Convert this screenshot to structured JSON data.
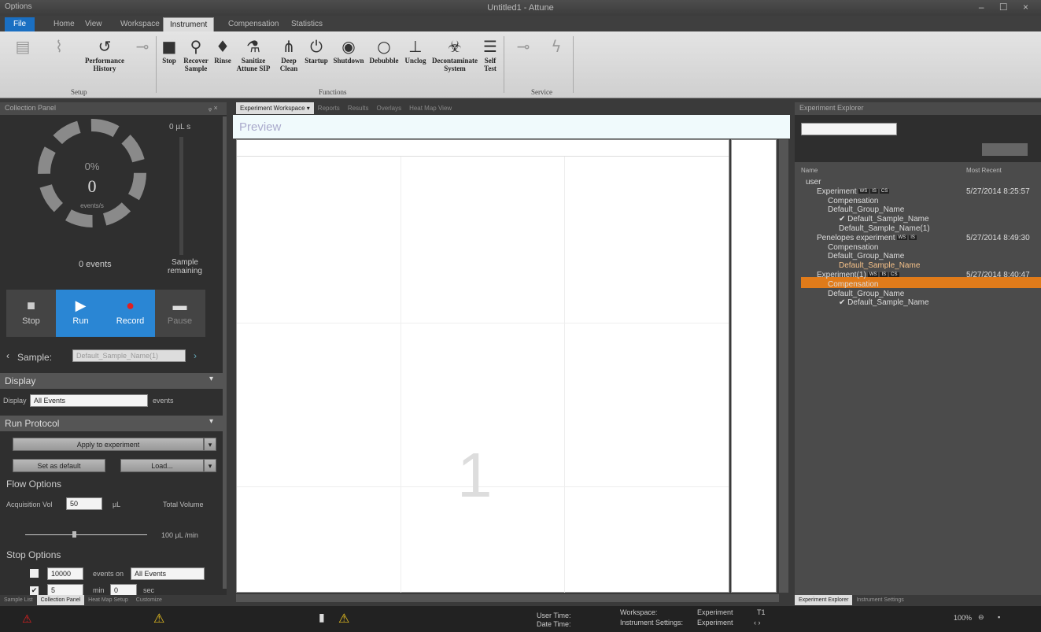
{
  "window": {
    "title": "Untitled1 - Attune",
    "quick_access": "Options",
    "controls": "– ☐ ×"
  },
  "ribbon": {
    "tabs": [
      "File",
      "Home",
      "View",
      "Workspace",
      "Instrument",
      "Compensation",
      "Statistics"
    ],
    "active_tab": "Instrument",
    "buttons": {
      "performance_history": "Performance History",
      "stop": "Stop",
      "recover_sample": "Recover Sample",
      "rinse": "Rinse",
      "sanitize": "Sanitize Attune SIP",
      "deep_clean": "Deep Clean",
      "startup": "Startup",
      "shutdown": "Shutdown",
      "debubble": "Debubble",
      "unclog": "Unclog",
      "decontaminate": "Decontaminate System",
      "self_test": "Self Test"
    },
    "groups": {
      "setup": "Setup",
      "functions": "Functions",
      "service": "Service"
    }
  },
  "collection_panel": {
    "title": "Collection Panel",
    "pin": "ᵩ ×",
    "volume": "0 µL s",
    "percent": "0%",
    "events_rate": "0",
    "events_rate_unit": "events/s",
    "events_total": "0 events",
    "sample_remaining": "Sample remaining",
    "buttons": {
      "stop": "Stop",
      "run": "Run",
      "record": "Record",
      "pause": "Pause"
    },
    "sample_label": "Sample:",
    "sample_value": "Default_Sample_Name(1)",
    "display": {
      "header": "Display",
      "label": "Display",
      "value": "All Events",
      "suffix": "events"
    },
    "run_protocol": {
      "header": "Run Protocol",
      "apply": "Apply to experiment",
      "set_default": "Set as default",
      "load": "Load...",
      "flow_options": "Flow Options",
      "acq_vol_label": "Acquisition Vol",
      "acq_vol_value": "50",
      "acq_vol_unit": "µL",
      "total_volume": "Total Volume",
      "flow_rate": "100 µL /min",
      "stop_options": "Stop Options",
      "events_value": "10000",
      "events_on": "events on",
      "events_gate": "All Events",
      "min_value": "5",
      "min_unit": "min",
      "sec_value": "0",
      "sec_unit": "sec"
    },
    "bottom_tabs": [
      "Sample List",
      "Collection Panel",
      "Heat Map Setup",
      "Customize"
    ]
  },
  "workspace": {
    "tabs": [
      "Experiment Workspace ▾",
      "Reports",
      "Results",
      "Overlays",
      "Heat Map View"
    ],
    "preview_title": "Preview",
    "page_number": "1"
  },
  "explorer": {
    "title": "Experiment Explorer",
    "col_name": "Name",
    "col_recent": "Most Recent",
    "tree": [
      {
        "level": 0,
        "text": "user",
        "icon": "▴ ▪"
      },
      {
        "level": 1,
        "text": "Experiment",
        "tags": [
          "WS",
          "IS",
          "CS"
        ],
        "date": "5/27/2014 8:25:57"
      },
      {
        "level": 2,
        "text": "Compensation"
      },
      {
        "level": 2,
        "text": "Default_Group_Name"
      },
      {
        "level": 3,
        "text": "✔ Default_Sample_Name"
      },
      {
        "level": 3,
        "text": "Default_Sample_Name(1)"
      },
      {
        "level": 1,
        "text": "Penelopes experiment",
        "tags": [
          "WS",
          "IS"
        ],
        "date": "5/27/2014 8:49:30"
      },
      {
        "level": 2,
        "text": "Compensation"
      },
      {
        "level": 2,
        "text": "Default_Group_Name"
      },
      {
        "level": 3,
        "text": "Default_Sample_Name",
        "selected": true
      },
      {
        "level": 1,
        "text": "Experiment(1)",
        "tags": [
          "WS",
          "IS",
          "CS"
        ],
        "date": "5/27/2014 8:40:47"
      },
      {
        "level": 2,
        "text": "Compensation"
      },
      {
        "level": 2,
        "text": "Default_Group_Name"
      },
      {
        "level": 3,
        "text": "✔ Default_Sample_Name"
      }
    ],
    "bottom_tabs": [
      "Experiment Explorer",
      "Instrument Settings"
    ]
  },
  "status": {
    "user_time": "User Time:",
    "date_time": "Date Time:",
    "workspace_label": "Workspace:",
    "workspace_value": "Experiment",
    "inst_label": "Instrument Settings:",
    "inst_value": "Experiment",
    "t1": "T1",
    "nav": "‹ ›",
    "zoom": "100%"
  },
  "colors": {
    "accent": "#2a86d4",
    "selected": "#e07b1a",
    "record": "#e02020"
  }
}
